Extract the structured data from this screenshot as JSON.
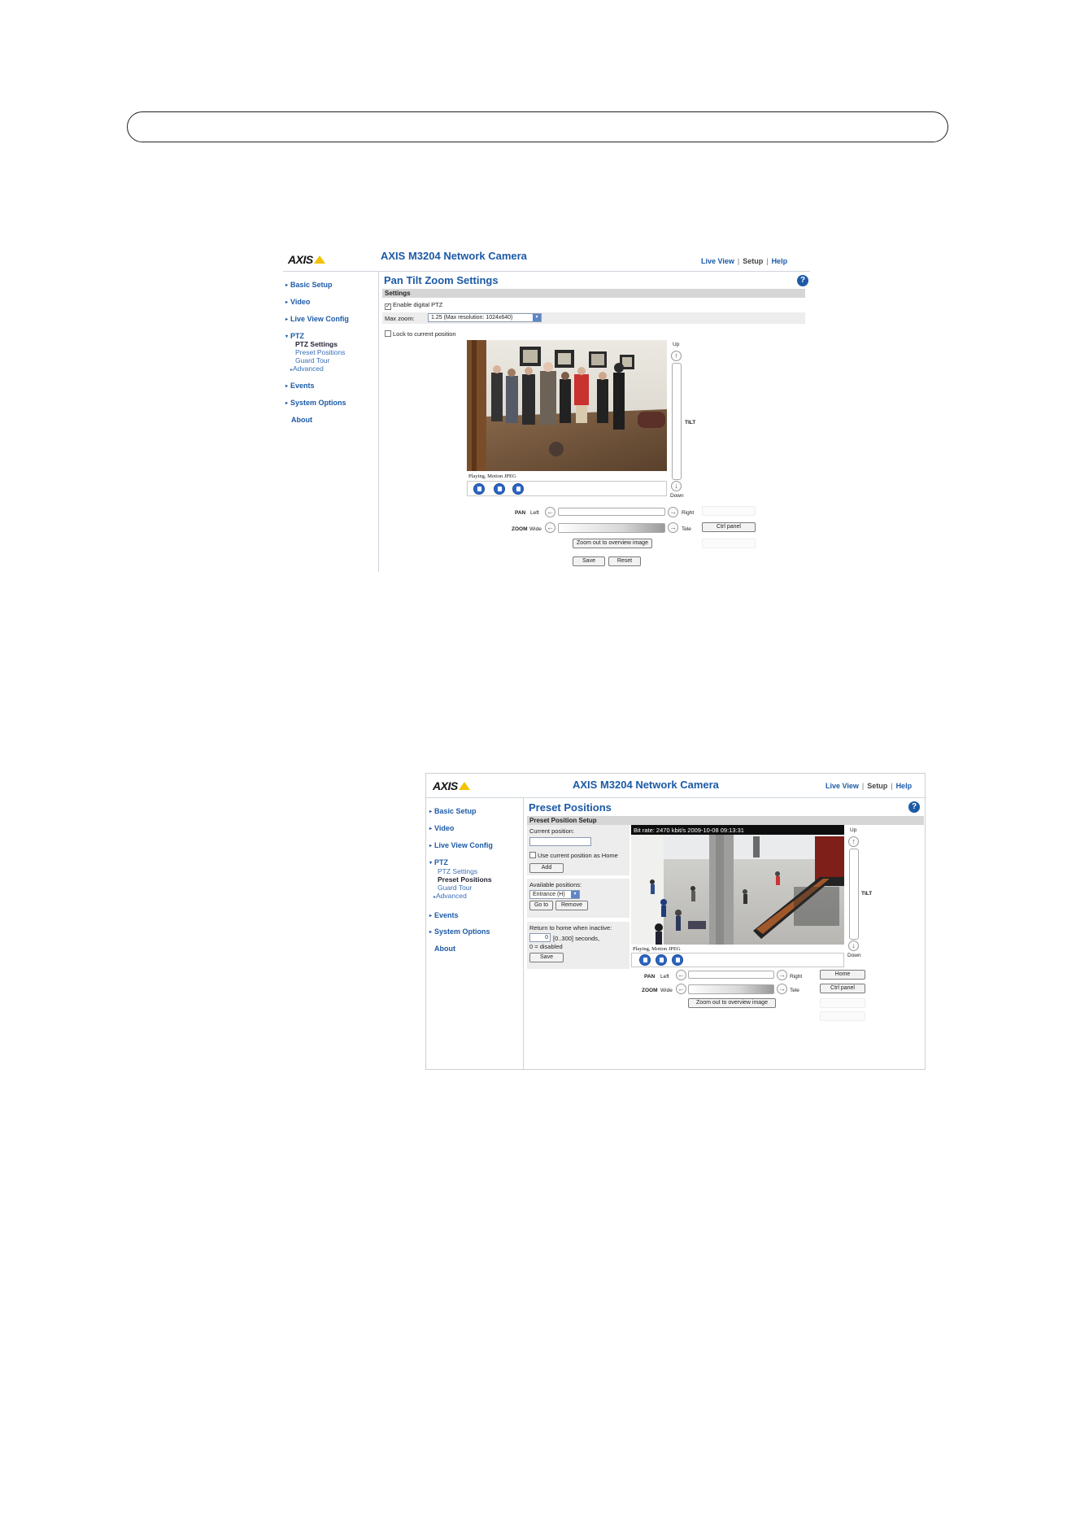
{
  "shot1": {
    "logo": "AXIS",
    "camera_title": "AXIS M3204 Network Camera",
    "toplinks": {
      "live_view": "Live View",
      "setup": "Setup",
      "help": "Help"
    },
    "nav": {
      "basic_setup": "Basic Setup",
      "video": "Video",
      "live_view_config": "Live View Config",
      "ptz": "PTZ",
      "ptz_settings": "PTZ Settings",
      "preset_positions": "Preset Positions",
      "guard_tour": "Guard Tour",
      "advanced": "Advanced",
      "events": "Events",
      "system_options": "System Options",
      "about": "About"
    },
    "page_title": "Pan Tilt Zoom Settings",
    "section_title": "Settings",
    "enable_digital_ptz": "Enable digital PTZ",
    "enable_digital_ptz_checked": true,
    "max_zoom_label": "Max zoom:",
    "max_zoom_value": "1.25 (Max resolution: 1024x640)",
    "lock_position": "Lock to current position",
    "lock_position_checked": false,
    "status": "Playing, Motion JPEG",
    "up": "Up",
    "down": "Down",
    "tilt": "TILT",
    "pan": "PAN",
    "left": "Left",
    "right": "Right",
    "zoom": "ZOOM",
    "wide": "Wide",
    "tele": "Tele",
    "ctrl_panel": "Ctrl panel",
    "zoom_out": "Zoom out to overview image",
    "save": "Save",
    "reset": "Reset"
  },
  "shot2": {
    "logo": "AXIS",
    "camera_title": "AXIS M3204 Network Camera",
    "toplinks": {
      "live_view": "Live View",
      "setup": "Setup",
      "help": "Help"
    },
    "nav": {
      "basic_setup": "Basic Setup",
      "video": "Video",
      "live_view_config": "Live View Config",
      "ptz": "PTZ",
      "ptz_settings": "PTZ Settings",
      "preset_positions": "Preset Positions",
      "guard_tour": "Guard Tour",
      "advanced": "Advanced",
      "events": "Events",
      "system_options": "System Options",
      "about": "About"
    },
    "page_title": "Preset Positions",
    "section_title": "Preset Position Setup",
    "current_position_label": "Current position:",
    "current_position_value": "",
    "use_as_home": "Use current position as Home",
    "use_as_home_checked": false,
    "add": "Add",
    "available_positions": "Available positions:",
    "available_selected": "Entrance (H)",
    "go_to": "Go to",
    "remove": "Remove",
    "return_home_label": "Return to home when inactive:",
    "return_home_value": "0",
    "return_home_range": "[0..300] seconds,",
    "return_home_note": "0 = disabled",
    "save": "Save",
    "overlay": "Bit rate:  2470 kbit/s 2009-10-08 09:13:31",
    "status": "Playing, Motion JPEG",
    "up": "Up",
    "down": "Down",
    "tilt": "TILT",
    "pan": "PAN",
    "left": "Left",
    "right": "Right",
    "zoom": "ZOOM",
    "wide": "Wide",
    "tele": "Tele",
    "home": "Home",
    "ctrl_panel": "Ctrl panel",
    "zoom_out": "Zoom out to overview image"
  }
}
